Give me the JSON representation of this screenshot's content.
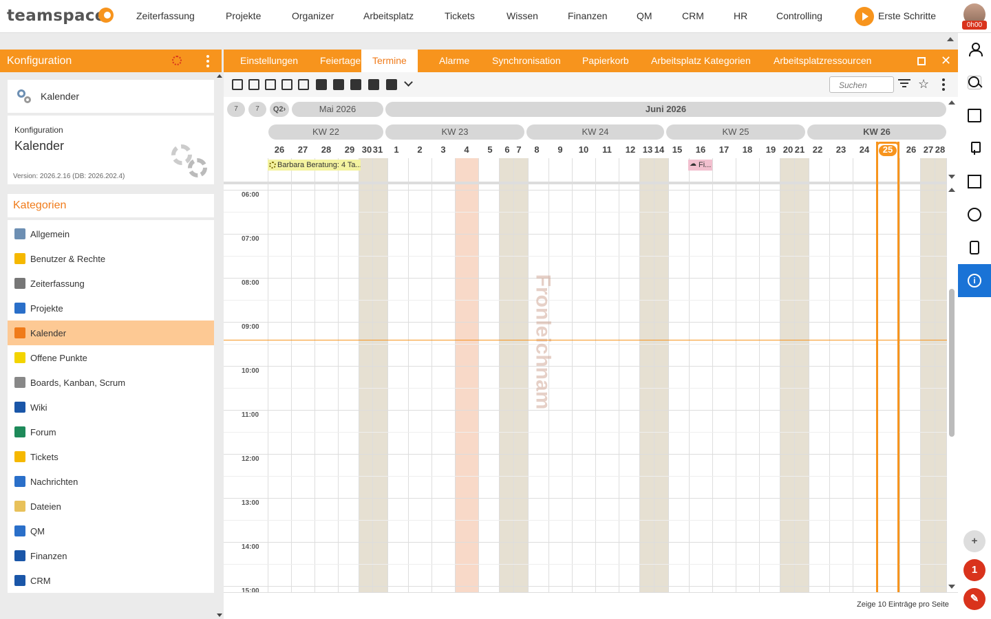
{
  "app": {
    "logo": "teamspace",
    "nav": [
      "Zeiterfassung",
      "Projekte",
      "Organizer",
      "Arbeitsplatz",
      "Tickets",
      "Wissen",
      "Finanzen",
      "QM",
      "CRM",
      "HR",
      "Controlling"
    ],
    "start_label": "Erste Schritte",
    "timer_badge": "0h00"
  },
  "left": {
    "header_title": "Konfiguration",
    "kalender_card_label": "Kalender",
    "info_small": "Konfiguration",
    "info_big": "Kalender",
    "version": "Version: 2026.2.16 (DB: 2026.202.4)",
    "categories_title": "Kategorien",
    "categories": [
      {
        "label": "Allgemein",
        "icon": "gears-icon",
        "color": "#6d8fb3"
      },
      {
        "label": "Benutzer & Rechte",
        "icon": "users-icon",
        "color": "#f5b800"
      },
      {
        "label": "Zeiterfassung",
        "icon": "stopwatch-icon",
        "color": "#777777"
      },
      {
        "label": "Projekte",
        "icon": "folder-icon",
        "color": "#2a6fc9"
      },
      {
        "label": "Kalender",
        "icon": "calendar-icon",
        "color": "#f07b1a"
      },
      {
        "label": "Offene Punkte",
        "icon": "sticky-note-icon",
        "color": "#f3d400"
      },
      {
        "label": "Boards, Kanban, Scrum",
        "icon": "kanban-icon",
        "color": "#888888"
      },
      {
        "label": "Wiki",
        "icon": "wiki-icon",
        "color": "#1a56a8"
      },
      {
        "label": "Forum",
        "icon": "globe-icon",
        "color": "#1e8a5a"
      },
      {
        "label": "Tickets",
        "icon": "ticket-icon",
        "color": "#f5b800"
      },
      {
        "label": "Nachrichten",
        "icon": "news-icon",
        "color": "#2a6fc9"
      },
      {
        "label": "Dateien",
        "icon": "files-icon",
        "color": "#e8c15a"
      },
      {
        "label": "QM",
        "icon": "qm-icon",
        "color": "#2a6fc9"
      },
      {
        "label": "Finanzen",
        "icon": "euro-icon",
        "color": "#1a56a8"
      },
      {
        "label": "CRM",
        "icon": "crm-icon",
        "color": "#1a56a8"
      }
    ],
    "active_category": "Kalender"
  },
  "tabs": [
    "Einstellungen",
    "Feiertage",
    "Termine",
    "Alarme",
    "Synchronisation",
    "Papierkorb",
    "Arbeitsplatz Kategorien",
    "Arbeitsplatzressourcen"
  ],
  "active_tab": "Termine",
  "toolbar": {
    "search_placeholder": "Suchen"
  },
  "calendar": {
    "q2_label": "Q2›",
    "nav_buttons": [
      "7",
      "7"
    ],
    "months": [
      {
        "label": "Mai 2026"
      },
      {
        "label": "Juni 2026"
      }
    ],
    "weeks": [
      "KW 22",
      "KW 23",
      "KW 24",
      "KW 25",
      "KW 26"
    ],
    "current_week": "KW 26",
    "days": [
      "26",
      "27",
      "28",
      "29",
      "30",
      "31",
      "1",
      "2",
      "3",
      "4",
      "5",
      "6",
      "7",
      "8",
      "9",
      "10",
      "11",
      "12",
      "13",
      "14",
      "15",
      "16",
      "17",
      "18",
      "19",
      "20",
      "21",
      "22",
      "23",
      "24",
      "25",
      "26",
      "27",
      "28"
    ],
    "today": "25",
    "times": [
      "06:00",
      "07:00",
      "08:00",
      "09:00",
      "10:00",
      "11:00",
      "12:00",
      "13:00",
      "14:00",
      "15:00"
    ],
    "events": [
      {
        "label": "Barbara Beratung: 4 Ta...",
        "color": "#f4f3a0",
        "icon": "sun-icon"
      },
      {
        "label": "Fi...",
        "color": "#f2c0cf",
        "icon": "rain-cloud-icon"
      }
    ],
    "holiday_label": "Fronleichnam",
    "holiday_color": "#f8d9c8",
    "weekend_color": "#e6e0d2"
  },
  "footer": {
    "text": "Zeige  10  Einträge pro Seite"
  },
  "rail": {
    "icons": [
      "users-icon",
      "search-icon",
      "inbox-icon",
      "pin-icon",
      "checklist-icon",
      "stopwatch-icon",
      "phone-icon",
      "info-icon"
    ],
    "notification_count": "1",
    "add_label": "+"
  },
  "colors": {
    "accent": "#f7941d",
    "info_blue": "#1a73d6",
    "danger": "#d9331c"
  }
}
